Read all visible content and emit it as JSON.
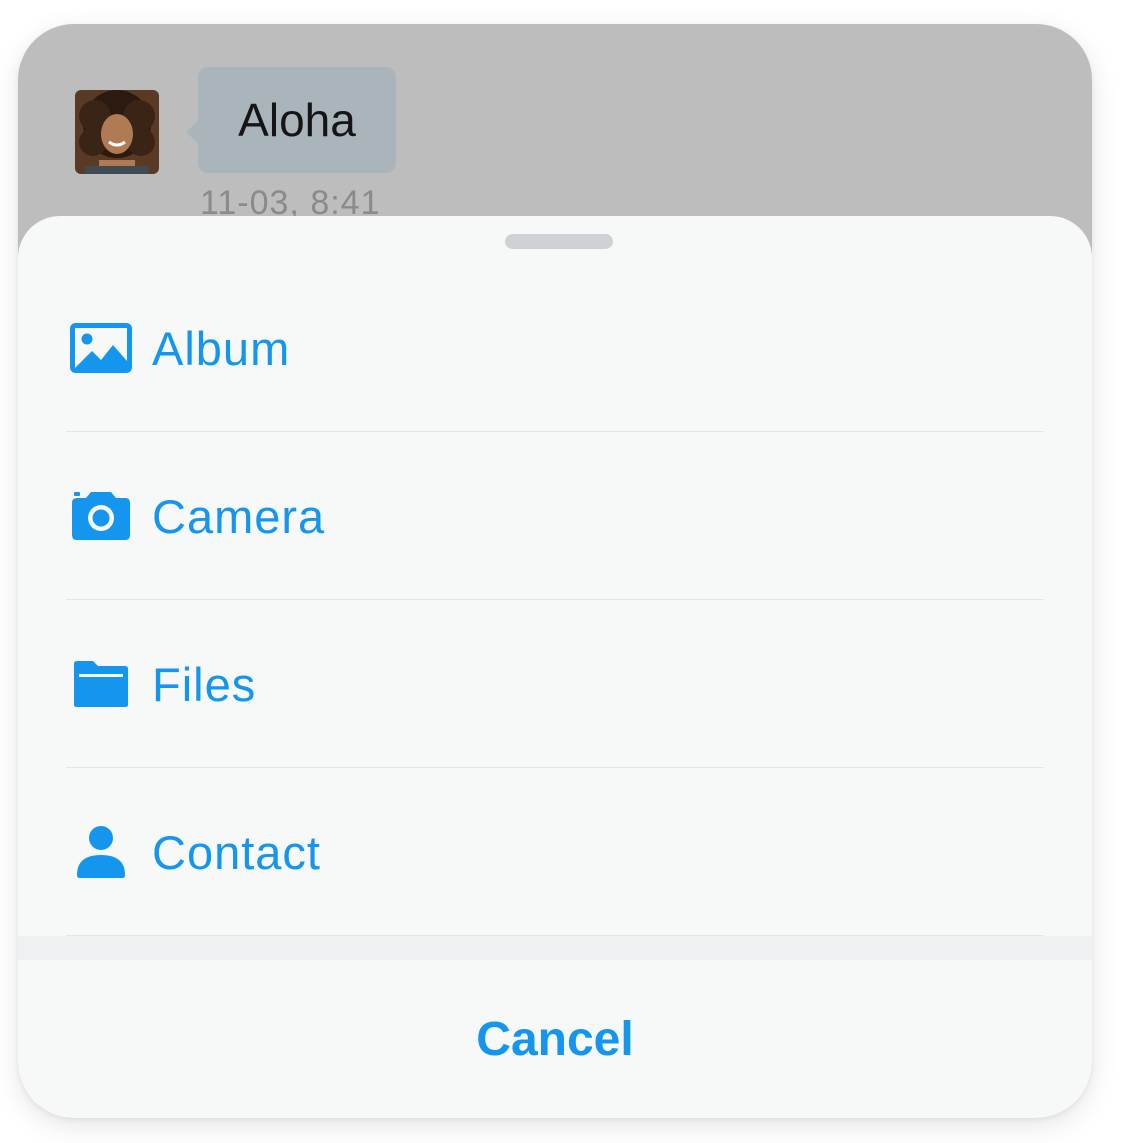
{
  "chat": {
    "message_text": "Aloha",
    "timestamp": "11-03, 8:41"
  },
  "action_sheet": {
    "items": [
      {
        "label": "Album",
        "icon": "image-icon"
      },
      {
        "label": "Camera",
        "icon": "camera-icon"
      },
      {
        "label": "Files",
        "icon": "folder-icon"
      },
      {
        "label": "Contact",
        "icon": "person-icon"
      }
    ],
    "cancel_label": "Cancel"
  },
  "colors": {
    "accent": "#1496ee",
    "overlay": "#bdbdbd",
    "bubble": "#a9b4bb",
    "sheet_background": "#f7f8f8"
  }
}
